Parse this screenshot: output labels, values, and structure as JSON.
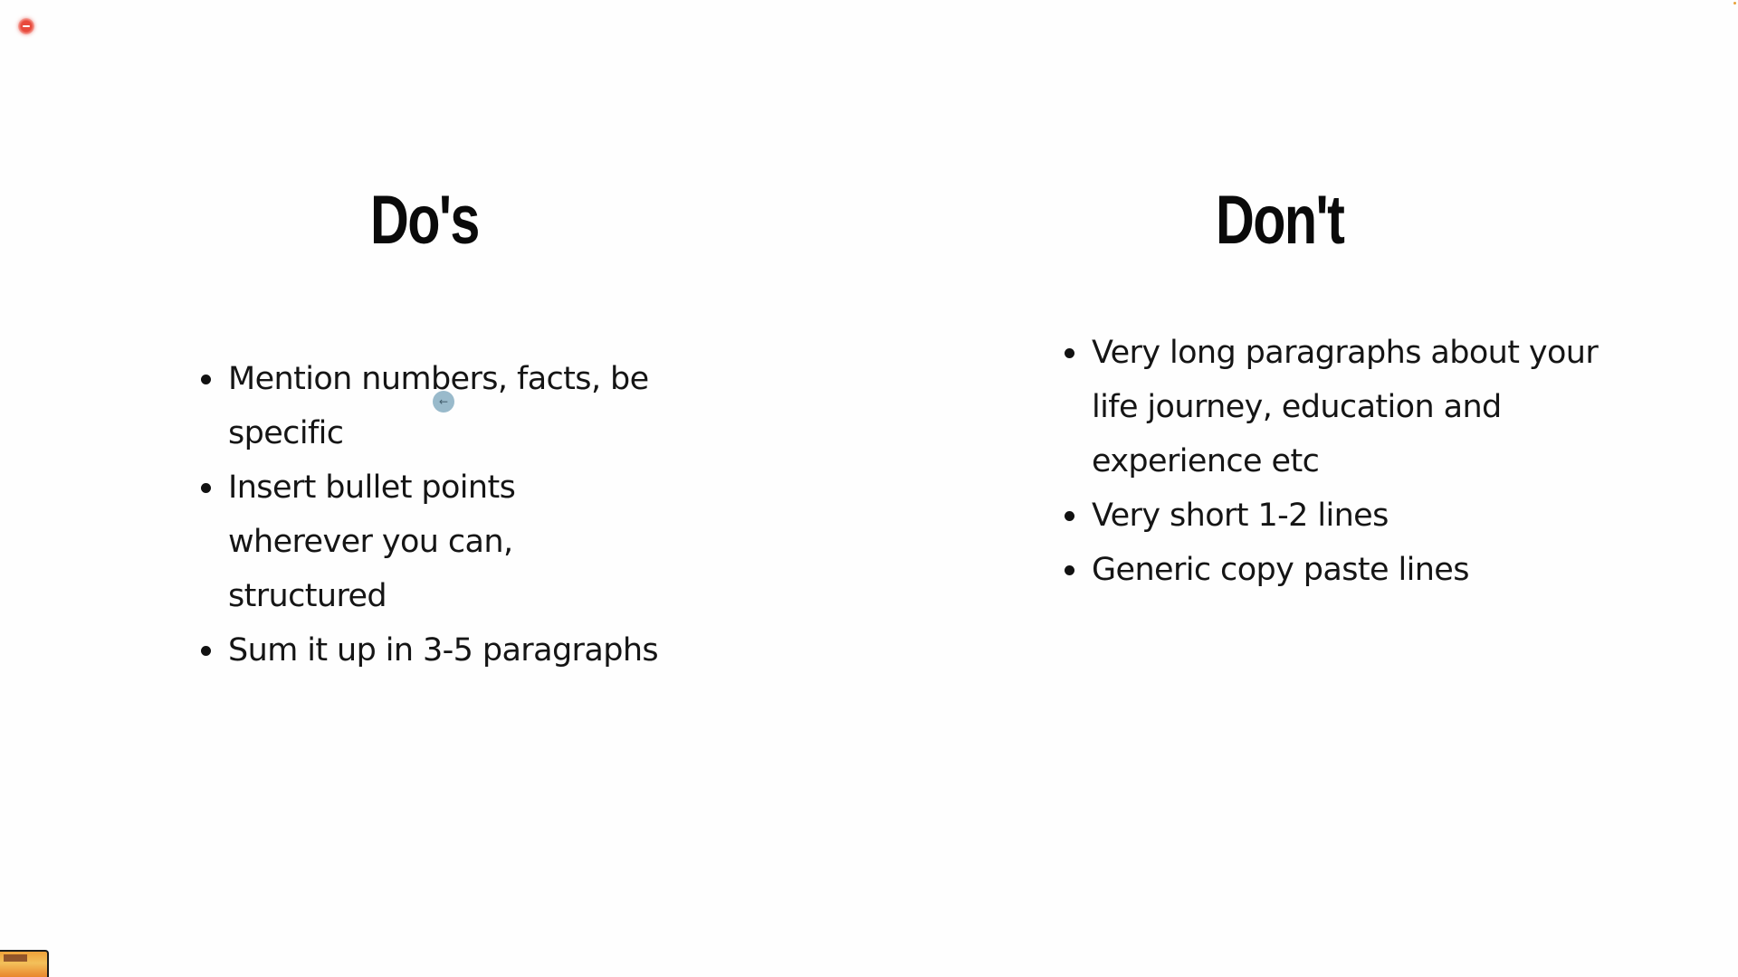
{
  "slide": {
    "dos": {
      "heading": "Do's",
      "items": [
        "Mention numbers, facts, be specific",
        "Insert bullet points wherever you can, structured",
        "Sum it up in 3-5 paragraphs"
      ]
    },
    "donts": {
      "heading": "Don't",
      "items": [
        "Very long paragraphs about your life journey, education and experience etc",
        "Very short 1-2 lines",
        "Generic copy paste lines"
      ]
    }
  },
  "overlay": {
    "record_indicator_icon": "record-stop-icon",
    "cursor_icon": "pointer-cursor-icon",
    "cursor_glyph": "←",
    "thumbnail": "webcam-thumbnail"
  },
  "colors": {
    "background": "#fefefe",
    "text": "#111111",
    "record": "#e84a3c",
    "cursor": "#8fb3c6"
  }
}
